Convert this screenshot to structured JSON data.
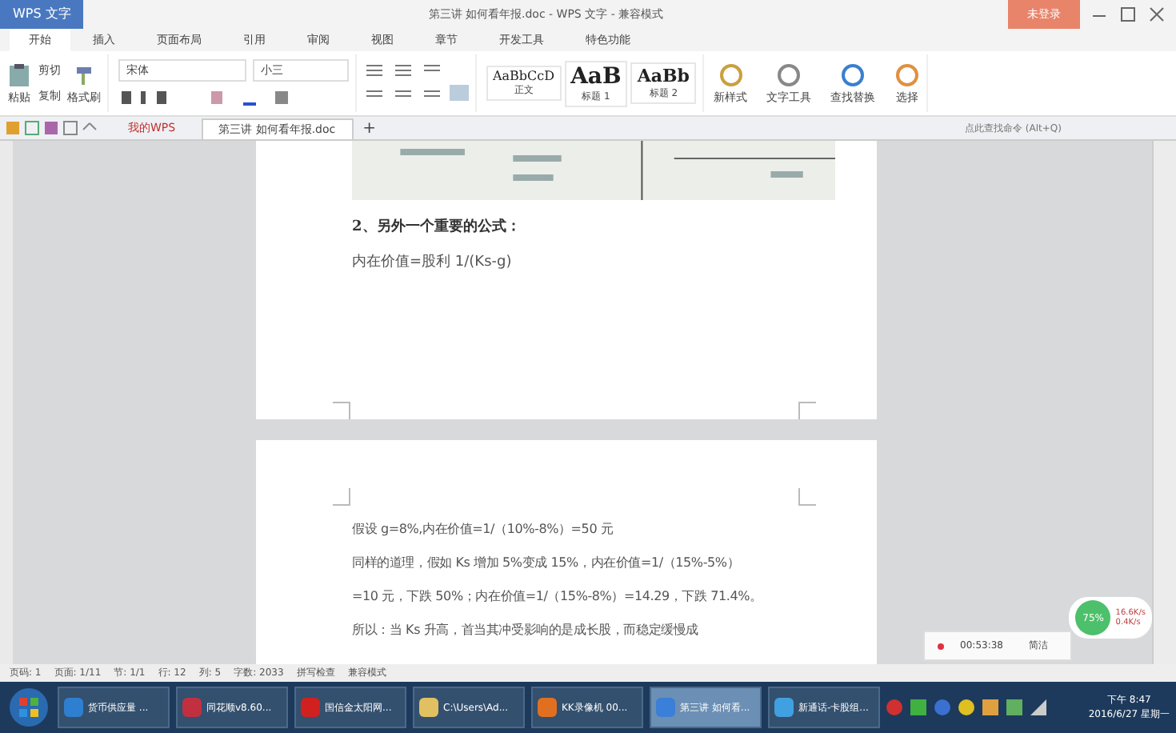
{
  "window": {
    "app_button": "WPS 文字",
    "title": "第三讲 如何看年报.doc - WPS 文字 - 兼容模式",
    "login_button": "未登录"
  },
  "menu_tabs": [
    {
      "label": "开始",
      "selected": true
    },
    {
      "label": "插入",
      "selected": false
    },
    {
      "label": "页面布局",
      "selected": false
    },
    {
      "label": "引用",
      "selected": false
    },
    {
      "label": "审阅",
      "selected": false
    },
    {
      "label": "视图",
      "selected": false
    },
    {
      "label": "章节",
      "selected": false
    },
    {
      "label": "开发工具",
      "selected": false
    },
    {
      "label": "特色功能",
      "selected": false
    }
  ],
  "ribbon": {
    "paste": "粘贴",
    "cut": "剪切",
    "copy": "复制",
    "format_painter": "格式刷",
    "font": "宋体",
    "size": "小三",
    "styles": [
      {
        "sample": "AaBbCcD",
        "label": "正文",
        "kind": "small"
      },
      {
        "sample": "AaB",
        "label": "标题 1",
        "kind": "big"
      },
      {
        "sample": "AaBb",
        "label": "标题 2",
        "kind": "mid"
      }
    ],
    "tools": [
      "新样式",
      "文字工具",
      "查找替换",
      "选择"
    ]
  },
  "doc_tabs": [
    {
      "label": "我的WPS",
      "selected": false
    },
    {
      "label": "第三讲 如何看年报.doc",
      "selected": true
    }
  ],
  "new_tab": "+",
  "command_search": {
    "placeholder": "点此查找命令 (Alt+Q)"
  },
  "page1": {
    "heading": "2、另外一个重要的公式：",
    "formula": "内在价值=股利 1/(Ks-g)"
  },
  "page2": {
    "lines": [
      "假设 g=8%,内在价值=1/（10%-8%）=50 元",
      "同样的道理，假如 Ks 增加 5%变成 15%，内在价值=1/（15%-5%）",
      "=10 元，下跌 50%；内在价值=1/（15%-8%）=14.29，下跌 71.4%。",
      "所以：当 Ks 升高，首当其冲受影响的是成长股，而稳定缓慢成"
    ]
  },
  "recorder": {
    "time": "00:53:38",
    "label": "简洁"
  },
  "network": {
    "percent": "75%",
    "up": "16.6K/s",
    "down": "0.4K/s"
  },
  "status_bar": [
    "页码: 1",
    "页面: 1/11",
    "节: 1/1",
    "行: 12",
    "列: 5",
    "字数: 2033",
    "拼写检查",
    "兼容模式"
  ],
  "taskbar": [
    {
      "label": "货币供应量 ...",
      "selected": false,
      "color": "#2f7fd0"
    },
    {
      "label": "同花顺v8.60...",
      "selected": false,
      "color": "#c03040"
    },
    {
      "label": "国信金太阳网...",
      "selected": false,
      "color": "#d02020"
    },
    {
      "label": "C:\\Users\\Ad...",
      "selected": false,
      "color": "#e0c060"
    },
    {
      "label": "KK录像机 00...",
      "selected": false,
      "color": "#e07020"
    },
    {
      "label": "第三讲 如何看...",
      "selected": true,
      "color": "#3a7fd8"
    },
    {
      "label": "新通话-卡股组...",
      "selected": false,
      "color": "#40a0e0"
    }
  ],
  "clock": {
    "time": "下午 8:47",
    "date": "2016/6/27 星期一"
  }
}
